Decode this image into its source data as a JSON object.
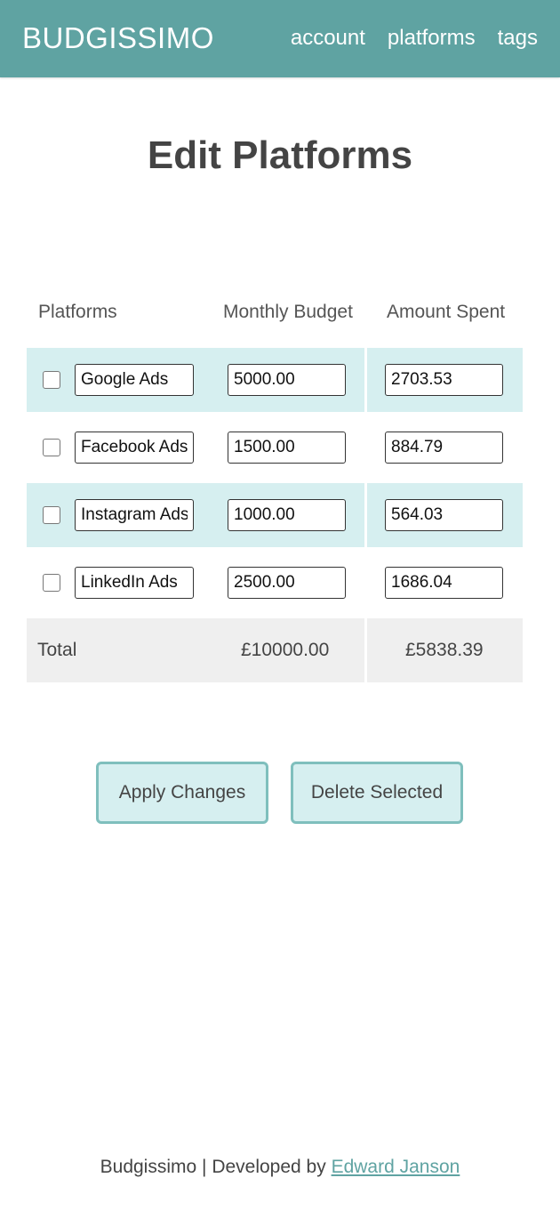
{
  "navbar": {
    "brand": "BUDGISSIMO",
    "links": [
      "account",
      "platforms",
      "tags"
    ]
  },
  "page_title": "Edit Platforms",
  "table": {
    "headers": [
      "Platforms",
      "Monthly Budget",
      "Amount Spent"
    ],
    "rows": [
      {
        "name": "Google Ads",
        "budget": "5000.00",
        "spent": "2703.53"
      },
      {
        "name": "Facebook Ads",
        "budget": "1500.00",
        "spent": "884.79"
      },
      {
        "name": "Instagram Ads",
        "budget": "1000.00",
        "spent": "564.03"
      },
      {
        "name": "LinkedIn Ads",
        "budget": "2500.00",
        "spent": "1686.04"
      }
    ],
    "total": {
      "label": "Total",
      "budget": "£10000.00",
      "spent": "£5838.39"
    }
  },
  "buttons": {
    "apply": "Apply Changes",
    "delete": "Delete Selected"
  },
  "footer": {
    "text": "Budgissimo | Developed by ",
    "link": "Edward Janson"
  },
  "colors": {
    "navbar": "#5fa3a2",
    "row_highlight": "#d6eff0",
    "total_row": "#efefef",
    "button_border": "#7fbfbd"
  }
}
